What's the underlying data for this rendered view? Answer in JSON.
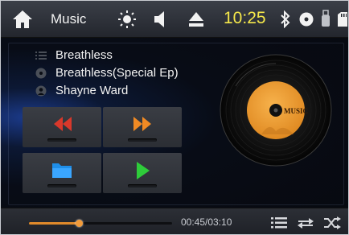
{
  "status_bar": {
    "title": "Music",
    "clock": "10:25",
    "clock_color": "#f5e84a"
  },
  "track": {
    "title": "Breathless",
    "album": "Breathless(Special Ep)",
    "artist": "Shayne Ward"
  },
  "album_art": {
    "label": "MUSIC",
    "label_color": "#f2a23a"
  },
  "controls": {
    "prev_icon": "rewind-icon",
    "next_icon": "fast-forward-icon",
    "folder_icon": "folder-icon",
    "play_icon": "play-icon",
    "accent_red": "#d9382b",
    "accent_orange": "#f08a24",
    "accent_blue": "#1f8ee8",
    "accent_green": "#2ecc3a"
  },
  "progress": {
    "time_text": "00:45/03:10",
    "fraction": 0.35,
    "color": "#e08a2b"
  },
  "bottom_icons": [
    "list-icon",
    "repeat-icon",
    "shuffle-icon"
  ]
}
